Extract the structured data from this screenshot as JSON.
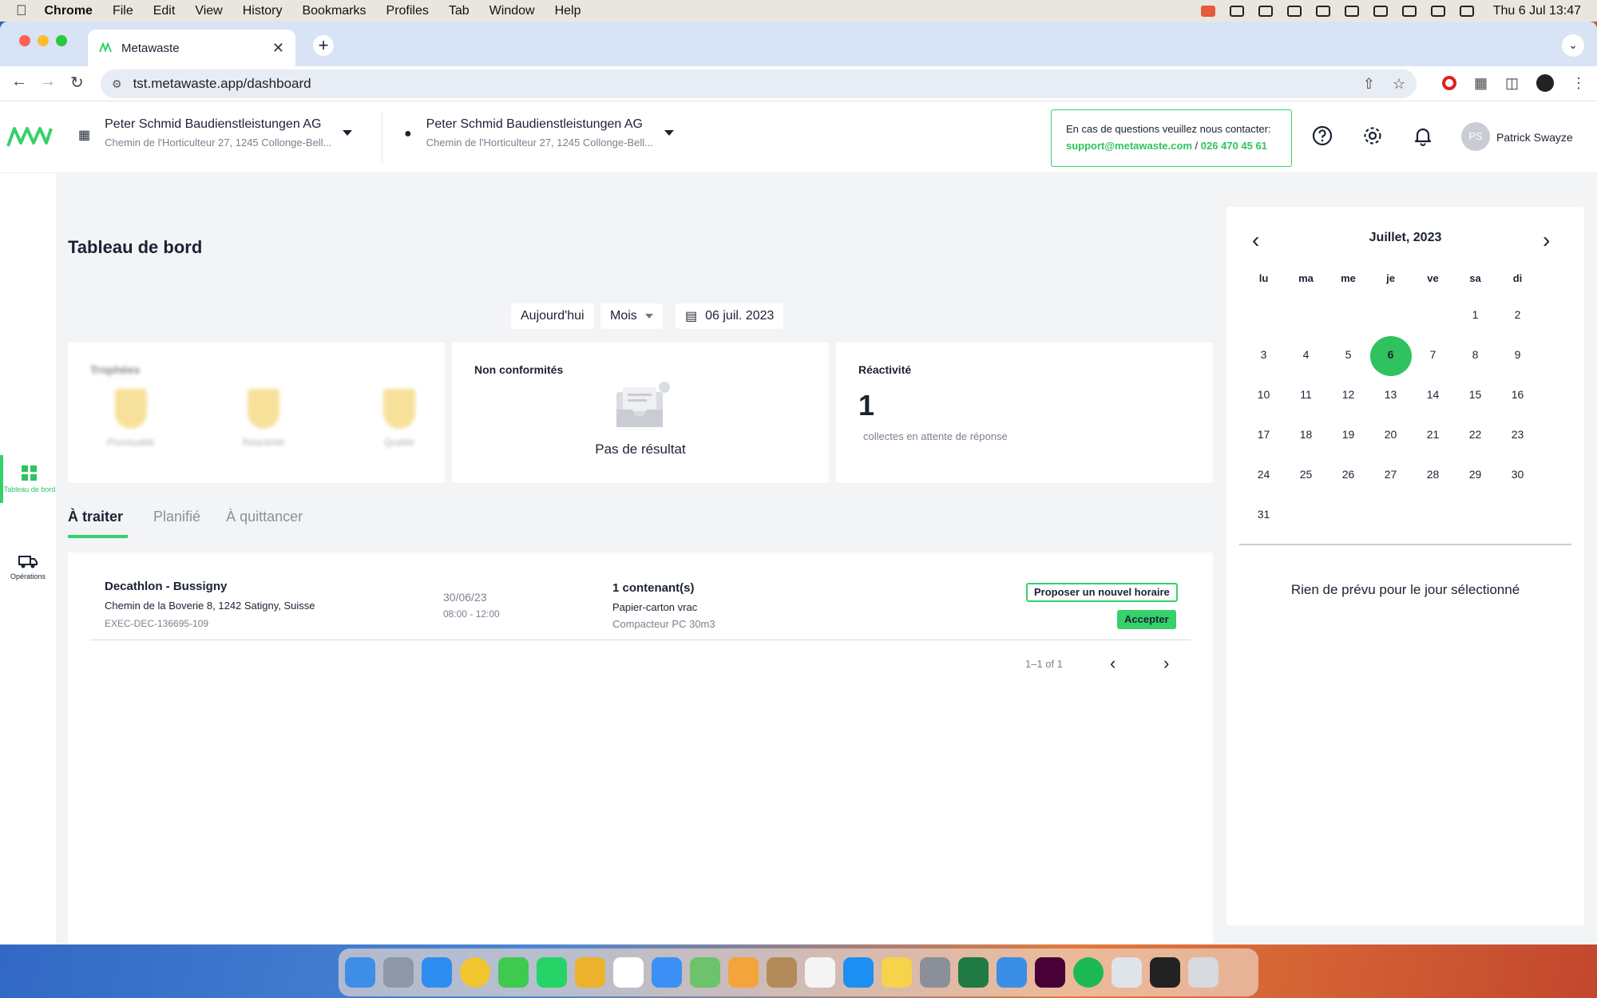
{
  "menubar": {
    "app": "Chrome",
    "items": [
      "File",
      "Edit",
      "View",
      "History",
      "Bookmarks",
      "Profiles",
      "Tab",
      "Window",
      "Help"
    ],
    "clock": "Thu 6 Jul  13:47"
  },
  "browser": {
    "tab_title": "Metawaste",
    "url": "tst.metawaste.app/dashboard"
  },
  "header": {
    "company": {
      "name": "Peter Schmid Baudienstleistungen AG",
      "address": "Chemin de l'Horticulteur 27, 1245 Collonge-Bell..."
    },
    "site": {
      "name": "Peter Schmid Baudienstleistungen AG",
      "address": "Chemin de l'Horticulteur 27, 1245 Collonge-Bell..."
    },
    "contact": {
      "label": "En cas de questions veuillez nous contacter:",
      "email": "support@metawaste.com",
      "separator": "/",
      "phone": "026 470 45 61"
    },
    "user": {
      "initials": "PS",
      "name": "Patrick Swayze"
    }
  },
  "sidenav": [
    {
      "label": "Tableau de bord"
    },
    {
      "label": "Opérations"
    }
  ],
  "page": {
    "title": "Tableau de bord",
    "filters": {
      "today": "Aujourd'hui",
      "period": "Mois",
      "date": "06 juil. 2023"
    }
  },
  "cards": {
    "trophies": {
      "title": "Trophées",
      "items": [
        "Ponctualité",
        "Réactivité",
        "Qualité"
      ]
    },
    "nonconf": {
      "title": "Non conformités",
      "empty": "Pas de résultat"
    },
    "reactivity": {
      "title": "Réactivité",
      "value": "1",
      "subtitle": "collectes en attente de réponse"
    }
  },
  "tabs": [
    "À traiter",
    "Planifié",
    "À quittancer"
  ],
  "rows": [
    {
      "name": "Decathlon - Bussigny",
      "address": "Chemin de la Boverie 8, 1242 Satigny, Suisse",
      "ref": "EXEC-DEC-136695-109",
      "date": "30/06/23",
      "hours": "08:00 - 12:00",
      "qty": "1 contenant(s)",
      "material": "Papier-carton vrac",
      "container": "Compacteur PC 30m3",
      "btn_propose": "Proposer un nouvel horaire",
      "btn_accept": "Accepter"
    }
  ],
  "pager": {
    "label": "1–1 of 1"
  },
  "calendar": {
    "title": "Juillet, 2023",
    "weekdays": [
      "lu",
      "ma",
      "me",
      "je",
      "ve",
      "sa",
      "di"
    ],
    "weeks": [
      [
        "",
        "",
        "",
        "",
        "",
        "1",
        "2"
      ],
      [
        "3",
        "4",
        "5",
        "6",
        "7",
        "8",
        "9"
      ],
      [
        "10",
        "11",
        "12",
        "13",
        "14",
        "15",
        "16"
      ],
      [
        "17",
        "18",
        "19",
        "20",
        "21",
        "22",
        "23"
      ],
      [
        "24",
        "25",
        "26",
        "27",
        "28",
        "29",
        "30"
      ],
      [
        "31",
        "",
        "",
        "",
        "",
        "",
        ""
      ]
    ],
    "selected": "6",
    "empty": "Rien de prévu pour le jour sélectionné"
  },
  "colors": {
    "accent": "#35d16b",
    "text": "#1b2233",
    "muted": "#7a8190"
  }
}
